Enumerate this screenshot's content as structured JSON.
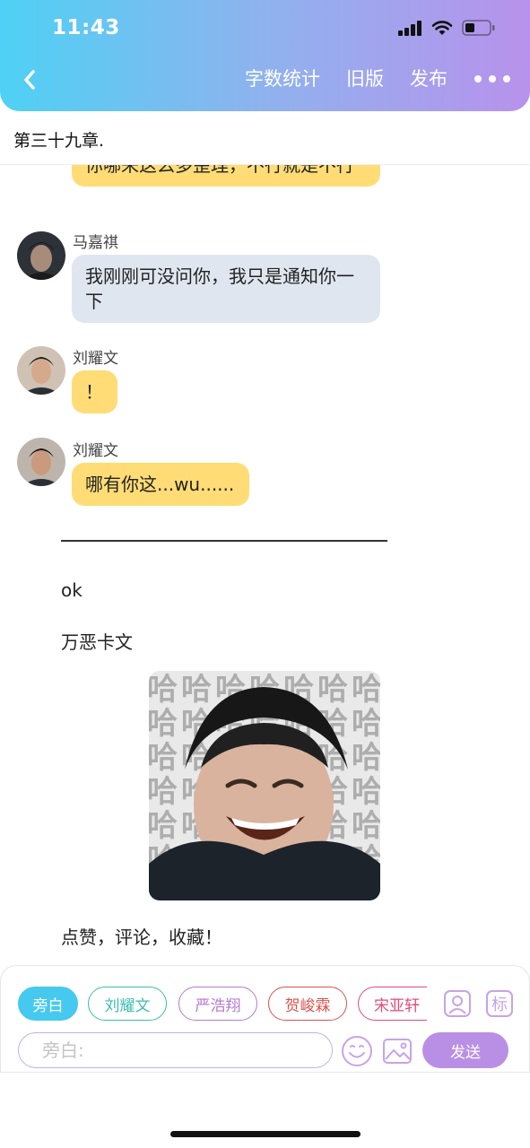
{
  "status_bar": {
    "time": "11:43",
    "icons": [
      "signal-icon",
      "wifi-icon",
      "battery-icon"
    ]
  },
  "header": {
    "back_icon": "chevron-left-icon",
    "actions": {
      "word_count": "字数统计",
      "old_version": "旧版",
      "publish": "发布"
    },
    "more_icon": "more-dots-icon",
    "colors": {
      "gradient_start": "#4ed1f4",
      "gradient_end": "#b892ec"
    }
  },
  "chapter": {
    "title": "第三十九章."
  },
  "messages": [
    {
      "speaker": "",
      "text": "你哪来这么多歪理，不行就是不行",
      "color": "#ffdc76"
    },
    {
      "speaker": "马嘉祺",
      "text": "我刚刚可没问你，我只是通知你一下",
      "color": "#e0e6ef"
    },
    {
      "speaker": "刘耀文",
      "text": "！",
      "color": "#ffdc76"
    },
    {
      "speaker": "刘耀文",
      "text": "哪有你这...wu......",
      "color": "#ffdc76"
    }
  ],
  "divider": "———————————————",
  "narration": {
    "ok": "ok",
    "card": "万恶卡文",
    "outro": "点赞，评论，收藏！"
  },
  "meme": {
    "caption_chars": "哈"
  },
  "composer": {
    "chips": [
      {
        "label": "旁白",
        "color": "#46c9ee",
        "active": true
      },
      {
        "label": "刘耀文",
        "color": "#3cbcb0",
        "active": false
      },
      {
        "label": "严浩翔",
        "color": "#b57ad0",
        "active": false
      },
      {
        "label": "贺峻霖",
        "color": "#d9534f",
        "active": false
      },
      {
        "label": "宋亚轩",
        "color": "#e04c7a",
        "active": false
      }
    ],
    "tool_icons": [
      "person-card-icon",
      "tag-icon",
      "emoji-icon",
      "image-icon"
    ],
    "tag_label": "标",
    "input_placeholder": "旁白:",
    "send_label": "发送",
    "accent": "#b98fe6"
  }
}
